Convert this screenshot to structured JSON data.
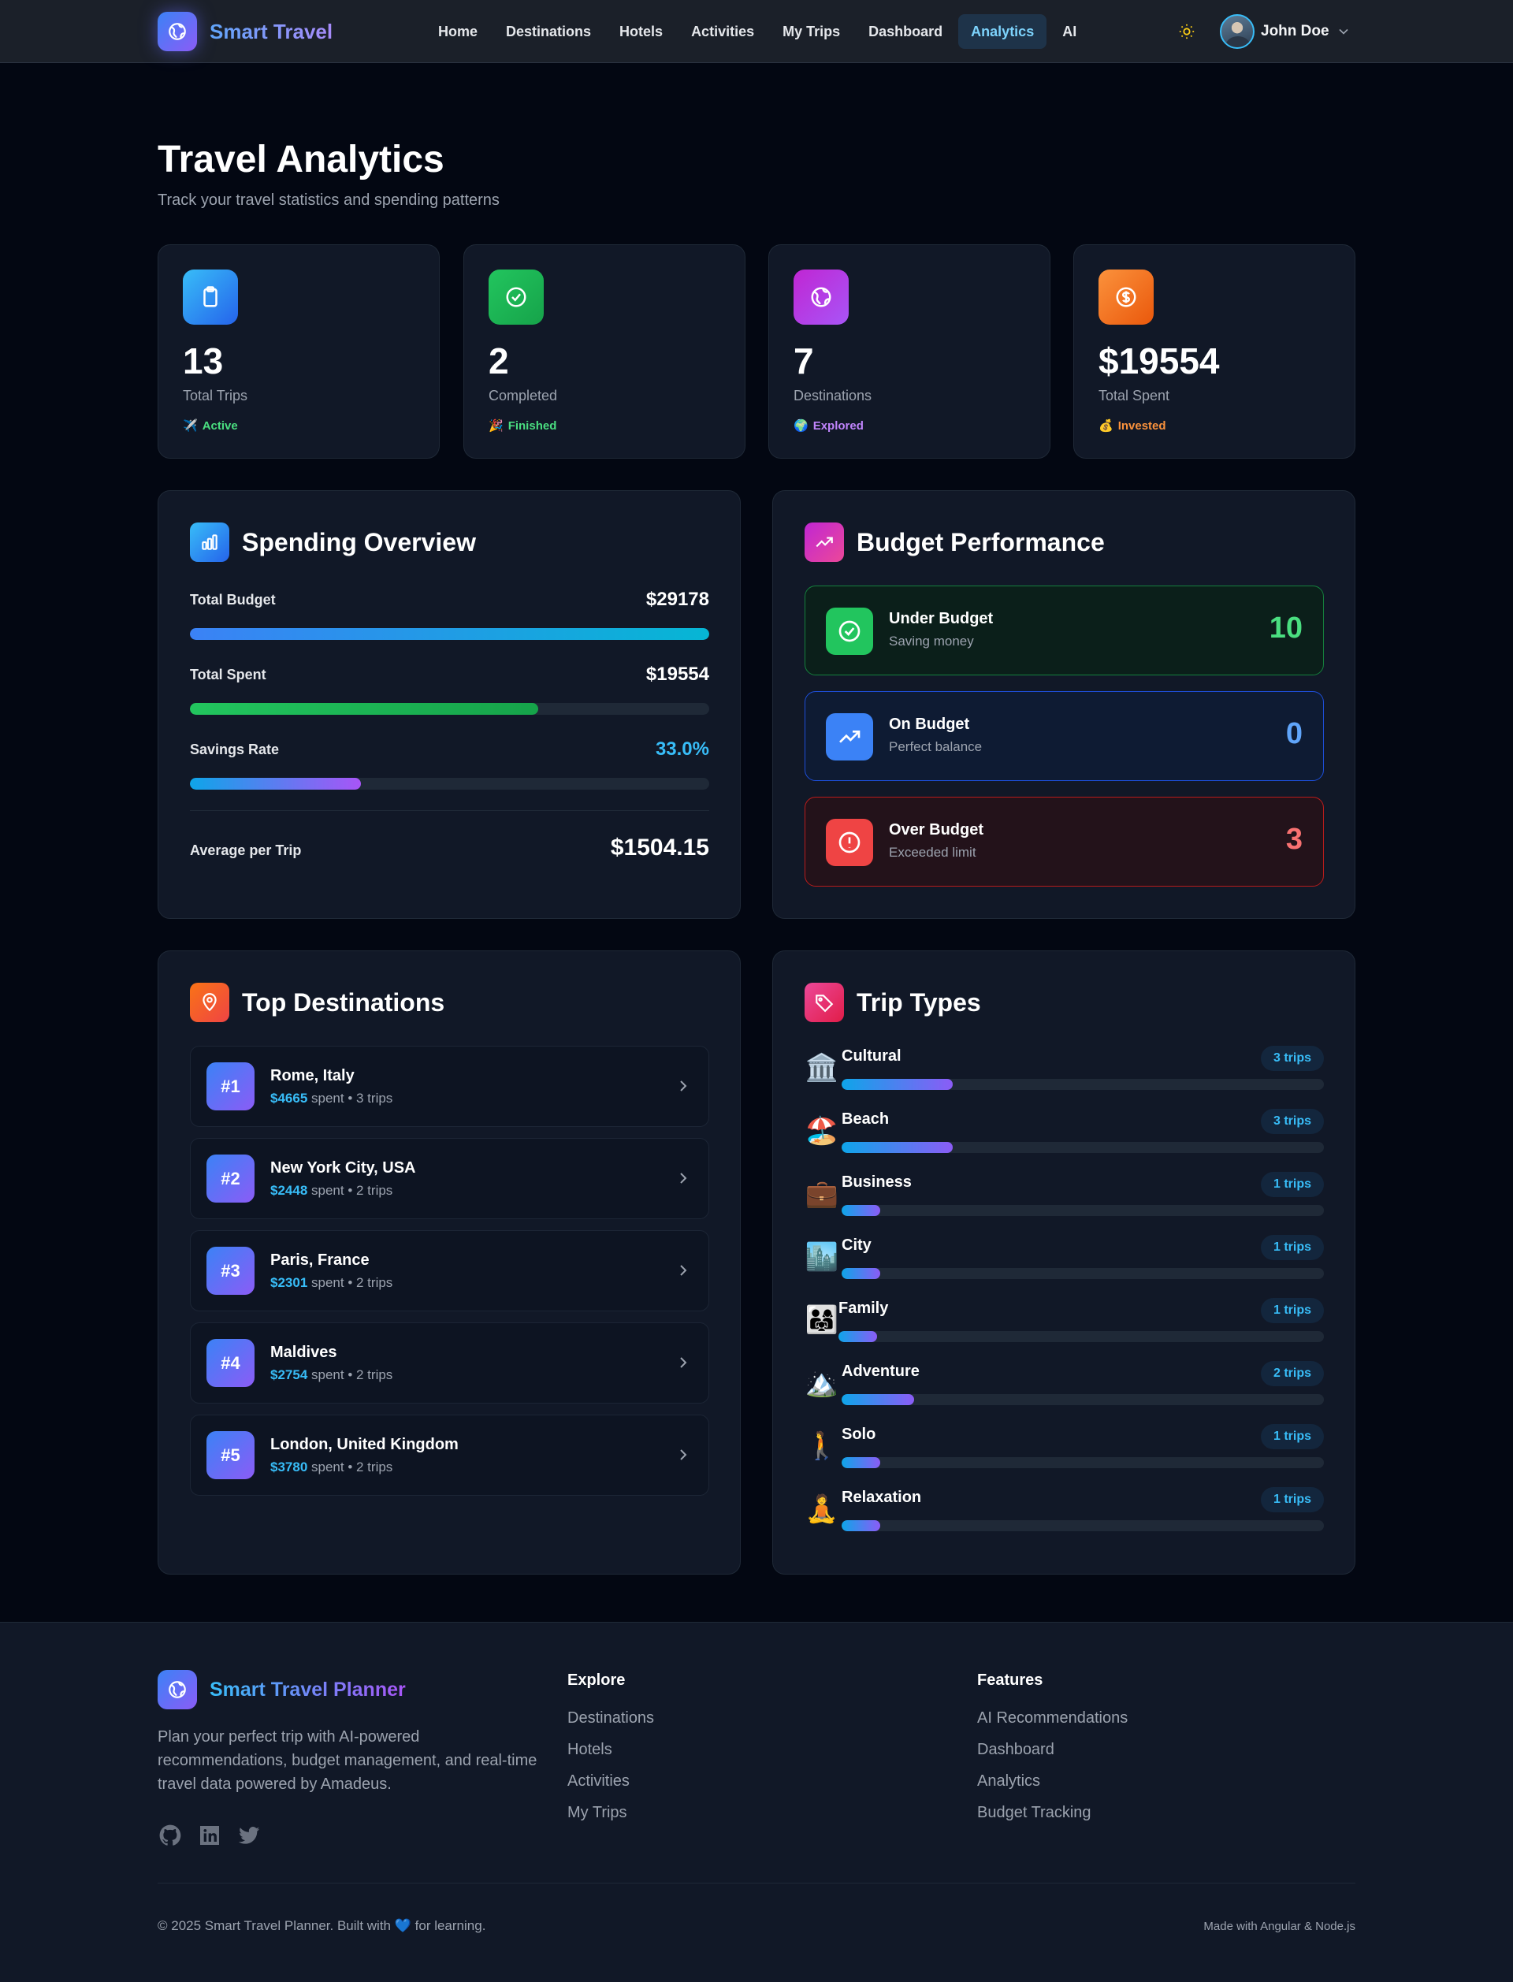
{
  "nav": {
    "brand": "Smart Travel",
    "links": [
      "Home",
      "Destinations",
      "Hotels",
      "Activities",
      "My Trips",
      "Dashboard",
      "Analytics",
      "AI"
    ],
    "active_link": "Analytics",
    "user_name": "John Doe"
  },
  "page": {
    "title": "Travel Analytics",
    "subtitle": "Track your travel statistics and spending patterns"
  },
  "stats": [
    {
      "value": "13",
      "label": "Total Trips",
      "badge": "Active",
      "badge_emoji": "✈️",
      "badge_color": "#4ade80",
      "icon": "clipboard-icon"
    },
    {
      "value": "2",
      "label": "Completed",
      "badge": "Finished",
      "badge_emoji": "🎉",
      "badge_color": "#4ade80",
      "icon": "check-circle-icon"
    },
    {
      "value": "7",
      "label": "Destinations",
      "badge": "Explored",
      "badge_emoji": "🌍",
      "badge_color": "#c084fc",
      "icon": "globe-icon"
    },
    {
      "value": "$19554",
      "label": "Total Spent",
      "badge": "Invested",
      "badge_emoji": "💰",
      "badge_color": "#fb923c",
      "icon": "dollar-icon"
    }
  ],
  "spending": {
    "title": "Spending Overview",
    "total_budget_label": "Total Budget",
    "total_budget_value": "$29178",
    "total_spent_label": "Total Spent",
    "total_spent_value": "$19554",
    "total_spent_fraction": 0.67,
    "savings_label": "Savings Rate",
    "savings_value": "33.0%",
    "savings_fraction": 0.33,
    "avg_label": "Average per Trip",
    "avg_value": "$1504.15"
  },
  "budget": {
    "title": "Budget Performance",
    "rows": [
      {
        "title": "Under Budget",
        "subtitle": "Saving money",
        "count": "10",
        "icon": "check-circle-icon"
      },
      {
        "title": "On Budget",
        "subtitle": "Perfect balance",
        "count": "0",
        "icon": "trending-up-icon"
      },
      {
        "title": "Over Budget",
        "subtitle": "Exceeded limit",
        "count": "3",
        "icon": "alert-circle-icon"
      }
    ]
  },
  "destinations": {
    "title": "Top Destinations",
    "items": [
      {
        "rank": "#1",
        "name": "Rome, Italy",
        "amount": "$4665",
        "meta": "spent • 3 trips"
      },
      {
        "rank": "#2",
        "name": "New York City, USA",
        "amount": "$2448",
        "meta": "spent • 2 trips"
      },
      {
        "rank": "#3",
        "name": "Paris, France",
        "amount": "$2301",
        "meta": "spent • 2 trips"
      },
      {
        "rank": "#4",
        "name": "Maldives",
        "amount": "$2754",
        "meta": "spent • 2 trips"
      },
      {
        "rank": "#5",
        "name": "London, United Kingdom",
        "amount": "$3780",
        "meta": "spent • 2 trips"
      }
    ]
  },
  "trip_types": {
    "title": "Trip Types",
    "items": [
      {
        "name": "Cultural",
        "emoji": "🏛️",
        "badge": "3 trips",
        "fraction": 0.23
      },
      {
        "name": "Beach",
        "emoji": "🏖️",
        "badge": "3 trips",
        "fraction": 0.23
      },
      {
        "name": "Business",
        "emoji": "💼",
        "badge": "1 trips",
        "fraction": 0.08
      },
      {
        "name": "City",
        "emoji": "🏙️",
        "badge": "1 trips",
        "fraction": 0.08
      },
      {
        "name": "Family",
        "emoji": "👨‍👩‍👧",
        "badge": "1 trips",
        "fraction": 0.08
      },
      {
        "name": "Adventure",
        "emoji": "🏔️",
        "badge": "2 trips",
        "fraction": 0.15
      },
      {
        "name": "Solo",
        "emoji": "🚶",
        "badge": "1 trips",
        "fraction": 0.08
      },
      {
        "name": "Relaxation",
        "emoji": "🧘",
        "badge": "1 trips",
        "fraction": 0.08
      }
    ]
  },
  "footer": {
    "brand": "Smart Travel Planner",
    "description": "Plan your perfect trip with AI-powered recommendations, budget management, and real-time travel data powered by Amadeus.",
    "explore_title": "Explore",
    "explore_links": [
      "Destinations",
      "Hotels",
      "Activities",
      "My Trips"
    ],
    "features_title": "Features",
    "features_links": [
      "AI Recommendations",
      "Dashboard",
      "Analytics",
      "Budget Tracking"
    ],
    "copyright_before": "© 2025 Smart Travel Planner. Built with",
    "copyright_heart": "💙",
    "copyright_after": "for learning.",
    "made_with": "Made with Angular & Node.js"
  },
  "colors": {
    "accent_blue": "#3b82f6",
    "accent_purple": "#8b5cf6",
    "green": "#22c55e",
    "red": "#ef4444",
    "orange": "#f97316"
  }
}
